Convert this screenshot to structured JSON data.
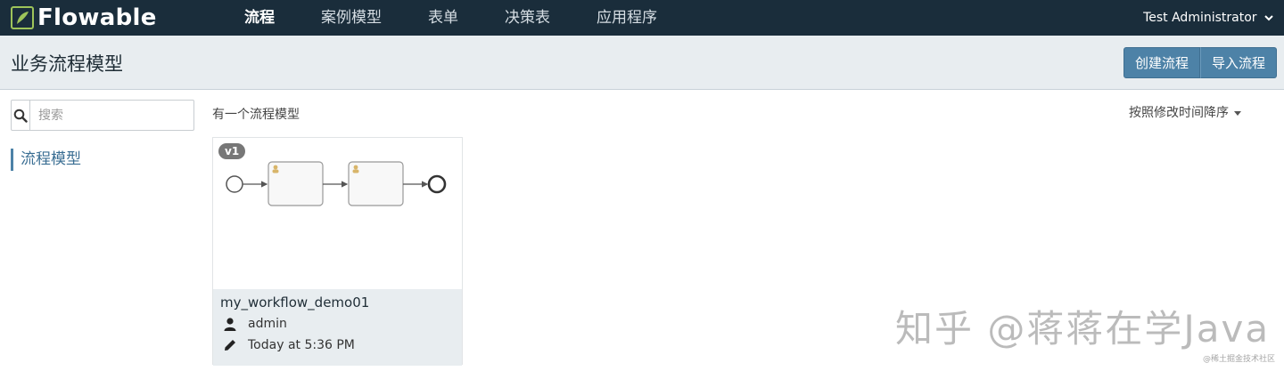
{
  "brand": {
    "logo_text": "Flowable",
    "accent": "#9ec45a",
    "nav_bg": "#1a2d3b"
  },
  "nav": {
    "items": [
      {
        "label": "流程",
        "active": true
      },
      {
        "label": "案例模型",
        "active": false
      },
      {
        "label": "表单",
        "active": false
      },
      {
        "label": "决策表",
        "active": false
      },
      {
        "label": "应用程序",
        "active": false
      }
    ],
    "user": "Test Administrator"
  },
  "header": {
    "title": "业务流程模型",
    "create_button": "创建流程",
    "import_button": "导入流程"
  },
  "sidebar": {
    "search_placeholder": "搜索",
    "link": "流程模型"
  },
  "main": {
    "count_text": "有一个流程模型",
    "sort_label": "按照修改时间降序"
  },
  "card": {
    "version": "v1",
    "name": "my_workflow_demo01",
    "owner": "admin",
    "modified": "Today at 5:36 PM",
    "icons": {
      "owner": "user-icon",
      "modified": "pencil-icon"
    }
  },
  "watermark": {
    "text": "知乎 @蒋蒋在学Java",
    "small": "@稀土掘金技术社区"
  }
}
